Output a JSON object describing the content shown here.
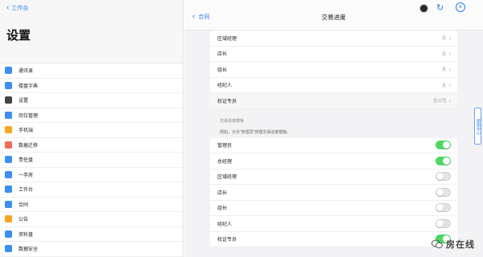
{
  "left_pane": {
    "back_label": "工作台",
    "title": "设置",
    "menu": [
      {
        "label": "通讯录",
        "icon": "contacts-icon",
        "color": "#3d8ef0"
      },
      {
        "label": "楼盘字典",
        "icon": "building-dictionary-icon",
        "color": "#3d8ef0"
      },
      {
        "label": "设置",
        "icon": "settings-icon",
        "color": "#444444"
      },
      {
        "label": "岗位管理",
        "icon": "position-management-icon",
        "color": "#3d8ef0"
      },
      {
        "label": "手机端",
        "icon": "mobile-icon",
        "color": "#f5a623"
      },
      {
        "label": "数据迁移",
        "icon": "data-migration-icon",
        "color": "#f06a5a"
      },
      {
        "label": "责任盘",
        "icon": "responsibility-icon",
        "color": "#3d8ef0"
      },
      {
        "label": "一手房",
        "icon": "new-house-icon",
        "color": "#3d8ef0"
      },
      {
        "label": "工作台",
        "icon": "workbench-icon",
        "color": "#3d8ef0"
      },
      {
        "label": "合同",
        "icon": "contract-icon",
        "color": "#3d8ef0"
      },
      {
        "label": "公告",
        "icon": "announcement-icon",
        "color": "#f5a623"
      },
      {
        "label": "资料盘",
        "icon": "files-icon",
        "color": "#3d8ef0"
      },
      {
        "label": "数据安全",
        "icon": "data-security-icon",
        "color": "#3d8ef0"
      }
    ]
  },
  "header": {
    "back_label": "合同",
    "title": "交易进度"
  },
  "rows_top": [
    {
      "label": "区域经理",
      "value": "无"
    },
    {
      "label": "店长",
      "value": "无"
    },
    {
      "label": "组长",
      "value": "无"
    },
    {
      "label": "经纪人",
      "value": "无"
    },
    {
      "label": "权证专员",
      "value": "全公司"
    }
  ],
  "section": {
    "heading": "交易进度模板",
    "description": "例如，允许“管理员”管理交易进度模板。"
  },
  "toggles": [
    {
      "label": "管理员",
      "on": true
    },
    {
      "label": "总经理",
      "on": true
    },
    {
      "label": "区域经理",
      "on": false
    },
    {
      "label": "店长",
      "on": false
    },
    {
      "label": "组长",
      "on": false
    },
    {
      "label": "经纪人",
      "on": false
    },
    {
      "label": "权证专员",
      "on": true
    }
  ],
  "side_tab": {
    "label": "帮助中心"
  },
  "watermark": {
    "text": "房在线"
  },
  "colors": {
    "accent": "#2f7bf2",
    "toggle_on": "#4cd964"
  }
}
